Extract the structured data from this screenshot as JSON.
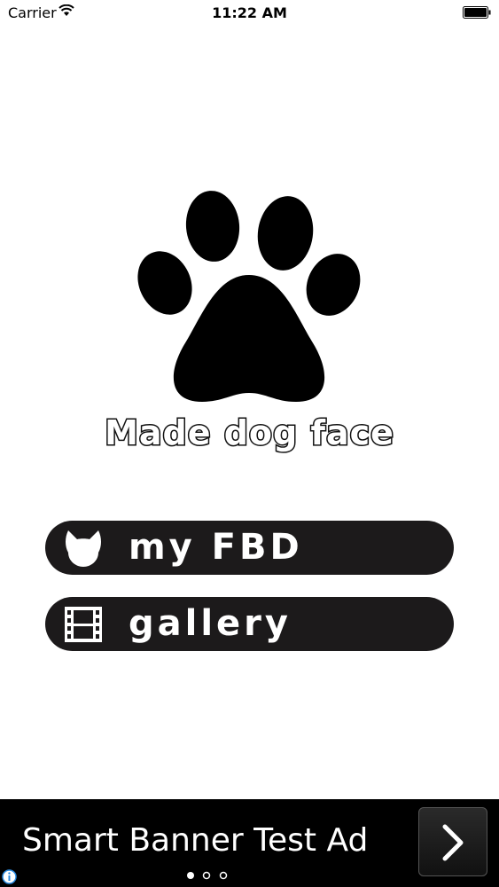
{
  "status_bar": {
    "carrier": "Carrier",
    "time": "11:22 AM",
    "icons": [
      "wifi-icon",
      "battery-icon"
    ]
  },
  "logo": {
    "icon": "paw-icon",
    "title": "Made dog face"
  },
  "menu": {
    "items": [
      {
        "icon": "dog-face-icon",
        "label": "my FBD"
      },
      {
        "icon": "film-icon",
        "label": "gallery"
      }
    ]
  },
  "ad": {
    "text": "Smart Banner Test Ad",
    "arrow_icon": "chevron-right-icon",
    "info_icon": "info-icon",
    "page_indicator": {
      "pages": 3,
      "current": 1
    }
  },
  "colors": {
    "background": "#ffffff",
    "button": "#1c1a1b",
    "ad_background": "#000000"
  }
}
